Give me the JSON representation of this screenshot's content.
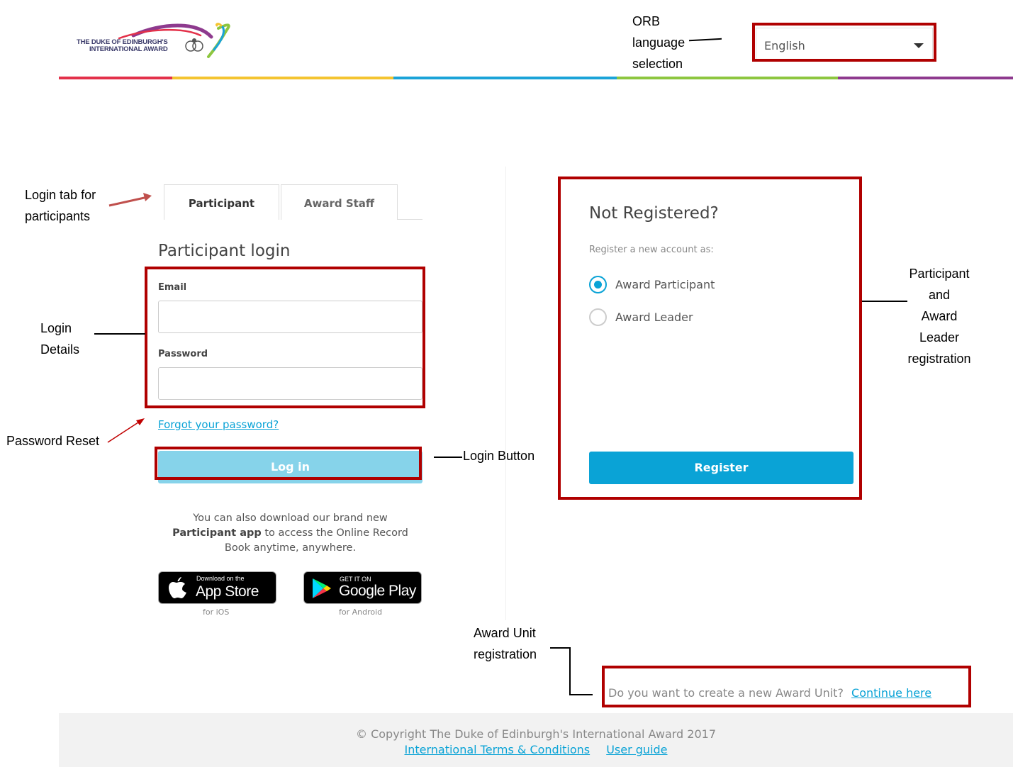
{
  "header": {
    "logo_line1": "THE DUKE OF EDINBURGH'S",
    "logo_line2": "INTERNATIONAL AWARD",
    "language": {
      "selected": "English"
    },
    "stripe_colors": [
      "#e3314a",
      "#f4c430",
      "#1ba3d8",
      "#8dc63f",
      "#8e3a8e"
    ]
  },
  "tabs": [
    {
      "label": "Participant",
      "active": true
    },
    {
      "label": "Award Staff",
      "active": false
    }
  ],
  "login": {
    "title": "Participant login",
    "email_label": "Email",
    "email_value": "",
    "password_label": "Password",
    "password_value": "",
    "forgot_link": "Forgot your password?",
    "login_button": "Log in"
  },
  "app_promo": {
    "text_before": "You can also download our brand new",
    "text_bold": "Participant app",
    "text_after": "to access the Online Record Book anytime, anywhere.",
    "app_store": {
      "small": "Download on the",
      "big": "App Store",
      "caption": "for iOS"
    },
    "google_play": {
      "small": "GET IT ON",
      "big": "Google Play",
      "caption": "for Android"
    }
  },
  "register": {
    "title": "Not Registered?",
    "subtitle": "Register a new account as:",
    "options": [
      {
        "label": "Award Participant",
        "checked": true
      },
      {
        "label": "Award Leader",
        "checked": false
      }
    ],
    "button": "Register"
  },
  "award_unit": {
    "question": "Do you want to create a new Award Unit?",
    "link": "Continue here"
  },
  "footer": {
    "copyright": "© Copyright The Duke of Edinburgh's International Award 2017",
    "links": [
      "International Terms & Conditions",
      "User guide"
    ]
  },
  "annotations": {
    "orb_language": [
      "ORB",
      "language",
      "selection"
    ],
    "login_tab": [
      "Login tab for",
      "participants"
    ],
    "login_details": [
      "Login",
      "Details"
    ],
    "password_reset": "Password Reset",
    "login_button": "Login Button",
    "registration": [
      "Participant",
      "and",
      "Award",
      "Leader",
      "registration"
    ],
    "award_unit": [
      "Award Unit",
      "registration"
    ]
  },
  "colors": {
    "accent": "#0aa3d6",
    "login_button": "#86d3ea",
    "callout": "#b00000"
  }
}
